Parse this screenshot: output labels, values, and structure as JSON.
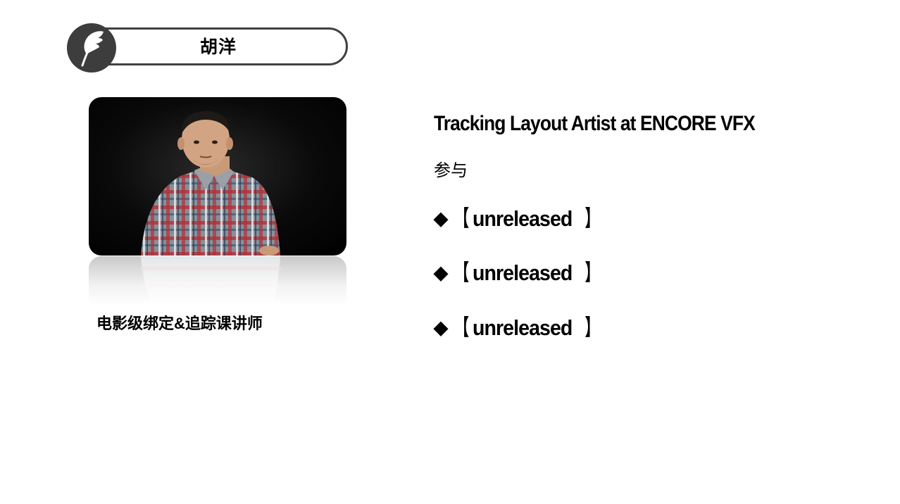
{
  "header": {
    "name": "胡洋",
    "icon": "feather-icon"
  },
  "profile": {
    "photo": "instructor-photo",
    "caption": "电影级绑定&追踪课讲师"
  },
  "details": {
    "job_title": "Tracking Layout Artist  at ENCORE VFX",
    "participate_label": "参与",
    "projects": [
      {
        "bullet": "◆",
        "open": "【",
        "name": "unreleased",
        "close": "】"
      },
      {
        "bullet": "◆",
        "open": "【",
        "name": " unreleased",
        "close": "】"
      },
      {
        "bullet": "◆",
        "open": "【",
        "name": " unreleased",
        "close": "】"
      }
    ]
  },
  "colors": {
    "pill_border": "#404040",
    "icon_circle": "#3d3d3d",
    "photo_background": "#000000",
    "text": "#000000"
  }
}
